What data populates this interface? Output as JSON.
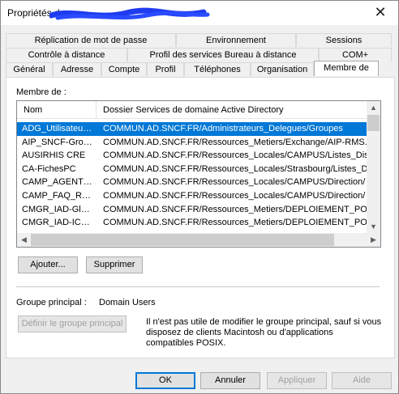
{
  "window": {
    "title": "Propriétés de",
    "close_label": "✕"
  },
  "tabs": {
    "row1": [
      "Réplication de mot de passe",
      "Environnement",
      "Sessions"
    ],
    "row2": [
      "Contrôle à distance",
      "Profil des services Bureau à distance",
      "COM+"
    ],
    "row3": [
      "Général",
      "Adresse",
      "Compte",
      "Profil",
      "Téléphones",
      "Organisation",
      "Membre de"
    ],
    "selected": "Membre de"
  },
  "member_of": {
    "label": "Membre de :",
    "columns": {
      "name": "Nom",
      "path": "Dossier Services de domaine Active Directory"
    },
    "rows": [
      {
        "name": "ADG_Utilisateurs...",
        "path": "COMMUN.AD.SNCF.FR/Administrateurs_Delegues/Groupes",
        "selected": true
      },
      {
        "name": "AIP_SNCF-Group...",
        "path": "COMMUN.AD.SNCF.FR/Ressources_Metiers/Exchange/AIP-RMS..."
      },
      {
        "name": "AUSIRHIS CRE",
        "path": "COMMUN.AD.SNCF.FR/Ressources_Locales/CAMPUS/Listes_Dis"
      },
      {
        "name": "CA-FichesPC",
        "path": "COMMUN.AD.SNCF.FR/Ressources_Locales/Strasbourg/Listes_D"
      },
      {
        "name": "CAMP_AGENT_...",
        "path": "COMMUN.AD.SNCF.FR/Ressources_Locales/CAMPUS/Direction/"
      },
      {
        "name": "CAMP_FAQ_RG...",
        "path": "COMMUN.AD.SNCF.FR/Ressources_Locales/CAMPUS/Direction/"
      },
      {
        "name": "CMGR_IAD-Glob...",
        "path": "COMMUN.AD.SNCF.FR/Ressources_Metiers/DEPLOIEMENT_PO"
      },
      {
        "name": "CMGR_IAD-IC@...",
        "path": "COMMUN.AD.SNCF.FR/Ressources_Metiers/DEPLOIEMENT_PO"
      }
    ]
  },
  "buttons": {
    "add": "Ajouter...",
    "remove": "Supprimer",
    "set_primary": "Définir le groupe principal",
    "ok": "OK",
    "cancel": "Annuler",
    "apply": "Appliquer",
    "help": "Aide"
  },
  "primary_group": {
    "label": "Groupe principal :",
    "value": "Domain Users",
    "note": "Il n'est pas utile de modifier le groupe principal, sauf si vous disposez de clients Macintosh ou d'applications compatibles POSIX."
  },
  "icons": {
    "close": "close-icon",
    "scroll_up": "arrow-up-icon",
    "scroll_down": "arrow-down-icon",
    "scroll_left": "arrow-left-icon",
    "scroll_right": "arrow-right-icon"
  },
  "colors": {
    "selection": "#0078d7",
    "redaction": "#1f3cf0"
  }
}
